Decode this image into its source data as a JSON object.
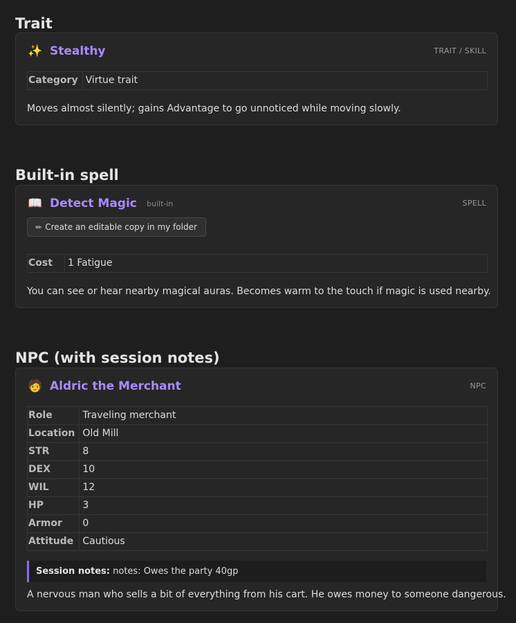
{
  "sections": {
    "trait": {
      "heading": "Trait",
      "icon": "sparkles-icon",
      "icon_glyph": "✨",
      "title": "Stealthy",
      "type": "TRAIT / SKILL",
      "props": [
        {
          "key": "Category",
          "value": "Virtue trait"
        }
      ],
      "description": "Moves almost silently; gains Advantage to go unnoticed while moving slowly."
    },
    "spell": {
      "heading": "Built-in spell",
      "icon": "book-icon",
      "icon_glyph": "📖",
      "title": "Detect Magic",
      "tag": "built-in",
      "type": "SPELL",
      "copy_button": "Create an editable copy in my folder",
      "props": [
        {
          "key": "Cost",
          "value": "1 Fatigue"
        }
      ],
      "description": "You can see or hear nearby magical auras. Becomes warm to the touch if magic is used nearby."
    },
    "npc": {
      "heading": "NPC (with session notes)",
      "icon": "person-icon",
      "icon_glyph": "🧑",
      "title": "Aldric the Merchant",
      "type": "NPC",
      "props": [
        {
          "key": "Role",
          "value": "Traveling merchant"
        },
        {
          "key": "Location",
          "value": "Old Mill"
        },
        {
          "key": "STR",
          "value": "8"
        },
        {
          "key": "DEX",
          "value": "10"
        },
        {
          "key": "WIL",
          "value": "12"
        },
        {
          "key": "HP",
          "value": "3"
        },
        {
          "key": "Armor",
          "value": "0"
        },
        {
          "key": "Attitude",
          "value": "Cautious"
        }
      ],
      "notes_label": "Session notes:",
      "notes_text": "notes: Owes the party 40gp",
      "description": "A nervous man who sells a bit of everything from his cart. He owes money to someone dangerous."
    }
  },
  "colors": {
    "background": "#1e1e1e",
    "card": "#262626",
    "accent": "#a78bfa",
    "callout_border": "#8b6cf0"
  }
}
